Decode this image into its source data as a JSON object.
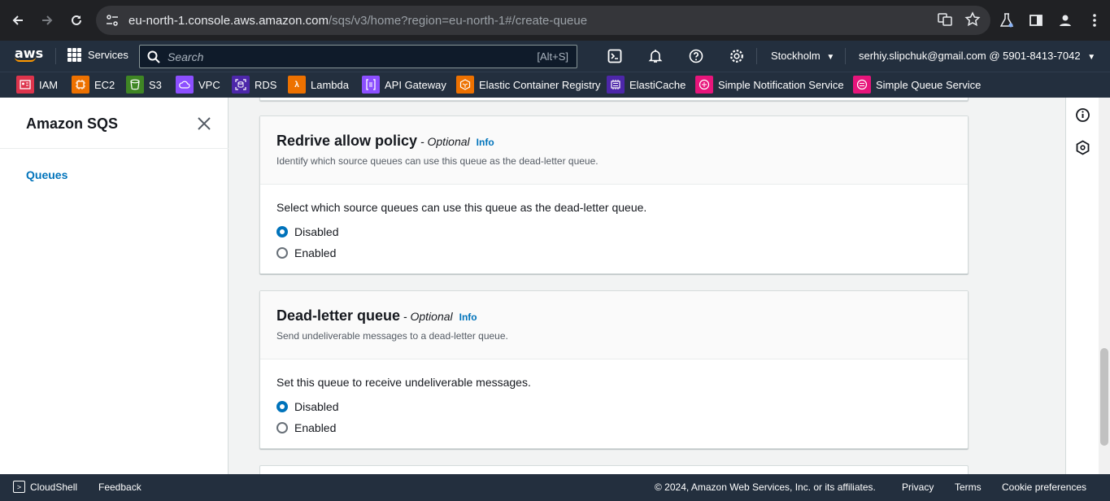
{
  "browser": {
    "url_host": "eu-north-1.console.aws.amazon.com",
    "url_path": "/sqs/v3/home?region=eu-north-1#/create-queue"
  },
  "nav": {
    "logo": "aws",
    "services_label": "Services",
    "search_placeholder": "Search",
    "search_shortcut": "[Alt+S]",
    "region": "Stockholm",
    "account": "serhiy.slipchuk@gmail.com @ 5901-8413-7042"
  },
  "favorites": [
    {
      "label": "IAM",
      "color": "#dd344c"
    },
    {
      "label": "EC2",
      "color": "#ed7100"
    },
    {
      "label": "S3",
      "color": "#3f8624"
    },
    {
      "label": "VPC",
      "color": "#8c4fff"
    },
    {
      "label": "RDS",
      "color": "#4d27aa"
    },
    {
      "label": "Lambda",
      "color": "#ed7100"
    },
    {
      "label": "API Gateway",
      "color": "#8c4fff"
    },
    {
      "label": "Elastic Container Registry",
      "color": "#ed7100"
    },
    {
      "label": "ElastiCache",
      "color": "#4d27aa"
    },
    {
      "label": "Simple Notification Service",
      "color": "#e7157b"
    },
    {
      "label": "Simple Queue Service",
      "color": "#e7157b"
    }
  ],
  "sidebar": {
    "title": "Amazon SQS",
    "items": [
      {
        "label": "Queues"
      }
    ]
  },
  "redrive": {
    "title": "Redrive allow policy",
    "optional": " - Optional",
    "info": "Info",
    "description": "Identify which source queues can use this queue as the dead-letter queue.",
    "question": "Select which source queues can use this queue as the dead-letter queue.",
    "options": [
      "Disabled",
      "Enabled"
    ],
    "selected": "Disabled"
  },
  "dlq": {
    "title": "Dead-letter queue",
    "optional": " - Optional",
    "info": "Info",
    "description": "Send undeliverable messages to a dead-letter queue.",
    "question": "Set this queue to receive undeliverable messages.",
    "options": [
      "Disabled",
      "Enabled"
    ],
    "selected": "Disabled"
  },
  "footer": {
    "cloudshell": "CloudShell",
    "feedback": "Feedback",
    "copyright": "© 2024, Amazon Web Services, Inc. or its affiliates.",
    "privacy": "Privacy",
    "terms": "Terms",
    "cookies": "Cookie preferences"
  },
  "colors": {
    "accent": "#0073bb",
    "nav_bg": "#232f3e",
    "aws_orange": "#ff9900"
  }
}
